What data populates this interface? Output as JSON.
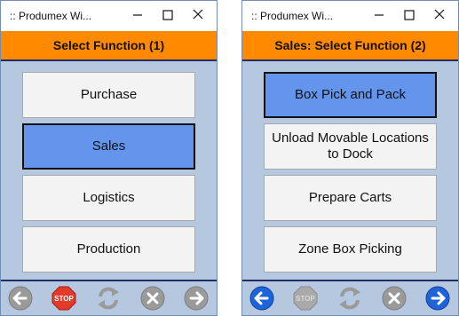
{
  "left": {
    "window_title": ":: Produmex Wi...",
    "header": "Select Function (1)",
    "buttons": [
      "Purchase",
      "Sales",
      "Logistics",
      "Production"
    ],
    "selected_index": 1
  },
  "right": {
    "window_title": ":: Produmex Wi...",
    "header": "Sales: Select Function (2)",
    "buttons": [
      "Box Pick and Pack",
      "Unload Movable Locations to Dock",
      "Prepare Carts",
      "Zone Box Picking"
    ],
    "selected_index": 0
  },
  "footer_icons": [
    "back-icon",
    "stop-icon",
    "refresh-icon",
    "cancel-icon",
    "forward-icon"
  ],
  "stop_label": "STOP",
  "colors": {
    "header": "#ff8a00",
    "background": "#b6c8e0",
    "selected": "#6495ed",
    "active_nav": "#1e64d8",
    "disabled": "#9a9a9a",
    "stop": "#e33a2a"
  }
}
